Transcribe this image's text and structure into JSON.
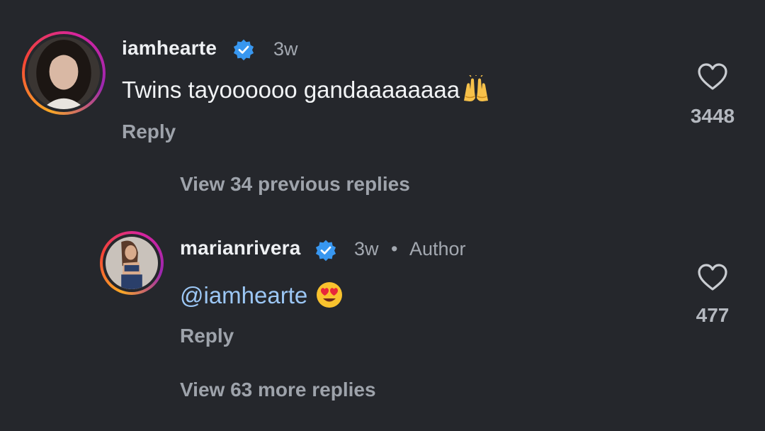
{
  "comments": [
    {
      "username": "iamhearte",
      "time": "3w",
      "text": "Twins tayoooooo gandaaaaaaaa",
      "emoji": "raising-hands",
      "reply_label": "Reply",
      "likes": "3448",
      "view_replies_label": "View 34 previous replies"
    },
    {
      "username": "marianrivera",
      "time": "3w",
      "separator": "•",
      "author_badge": "Author",
      "mention": "@iamhearte",
      "emoji": "heart-eyes",
      "reply_label": "Reply",
      "likes": "477",
      "view_replies_label": "View 63 more replies"
    }
  ],
  "colors": {
    "background": "#25272c",
    "verified": "#3897f0",
    "mention": "#9cc7f5",
    "ring_start": "#f9a825",
    "ring_end": "#d6249f"
  }
}
